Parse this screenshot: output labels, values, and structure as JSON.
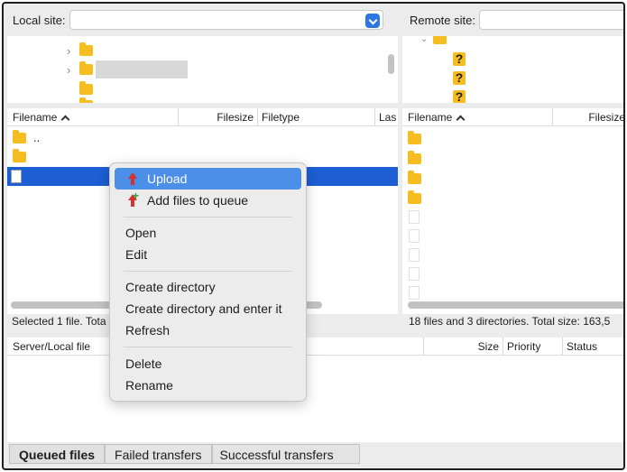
{
  "local_site": {
    "label": "Local site:",
    "value": ""
  },
  "remote_site": {
    "label": "Remote site:",
    "value": ""
  },
  "local_files": {
    "columns": [
      "Filename",
      "Filesize",
      "Filetype",
      "Las"
    ],
    "rows": [
      ".."
    ],
    "status": "Selected 1 file. Tota"
  },
  "remote_files": {
    "columns": [
      "Filename",
      "Filesize"
    ],
    "status": "18 files and 3 directories. Total size: 163,5"
  },
  "queue": {
    "columns": [
      "Server/Local file",
      "Size",
      "Priority",
      "Status"
    ]
  },
  "tabs": [
    "Queued files",
    "Failed transfers",
    "Successful transfers"
  ],
  "context_menu": {
    "upload": "Upload",
    "add_to_queue": "Add files to queue",
    "open": "Open",
    "edit": "Edit",
    "create_dir": "Create directory",
    "create_dir_enter": "Create directory and enter it",
    "refresh": "Refresh",
    "delete": "Delete",
    "rename": "Rename"
  },
  "icons": {
    "folder": "folder-icon",
    "file": "file-icon",
    "unknown": "question-mark-icon",
    "upload": "upload-arrow-icon",
    "add_queue": "add-queue-icon"
  },
  "colors": {
    "selection": "#1d5ed4",
    "menu_highlight": "#4b8fe8",
    "folder": "#f5bd1f"
  }
}
